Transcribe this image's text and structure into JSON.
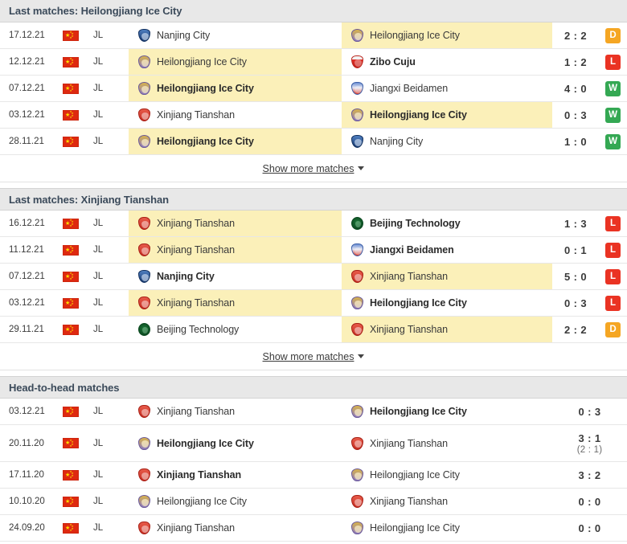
{
  "sections": [
    {
      "id": "last-matches-heilongjiang",
      "title": "Last matches: Heilongjiang Ice City",
      "show_more_label": "Show more matches",
      "has_show_more": true,
      "has_result_badge": true,
      "rows": [
        {
          "date": "17.12.21",
          "country": "China",
          "league": "JL",
          "home": "Nanjing City",
          "home_logo": "nanjing",
          "home_bold": false,
          "home_highlight": false,
          "away": "Heilongjiang Ice City",
          "away_logo": "heilongjiang",
          "away_bold": false,
          "away_highlight": true,
          "score": "2 : 2",
          "score_sub": "",
          "result": "D"
        },
        {
          "date": "12.12.21",
          "country": "China",
          "league": "JL",
          "home": "Heilongjiang Ice City",
          "home_logo": "heilongjiang",
          "home_bold": false,
          "home_highlight": true,
          "away": "Zibo Cuju",
          "away_logo": "zibo",
          "away_bold": true,
          "away_highlight": false,
          "score": "1 : 2",
          "score_sub": "",
          "result": "L"
        },
        {
          "date": "07.12.21",
          "country": "China",
          "league": "JL",
          "home": "Heilongjiang Ice City",
          "home_logo": "heilongjiang",
          "home_bold": true,
          "home_highlight": true,
          "away": "Jiangxi Beidamen",
          "away_logo": "jiangxi",
          "away_bold": false,
          "away_highlight": false,
          "score": "4 : 0",
          "score_sub": "",
          "result": "W"
        },
        {
          "date": "03.12.21",
          "country": "China",
          "league": "JL",
          "home": "Xinjiang Tianshan",
          "home_logo": "xinjiang",
          "home_bold": false,
          "home_highlight": false,
          "away": "Heilongjiang Ice City",
          "away_logo": "heilongjiang",
          "away_bold": true,
          "away_highlight": true,
          "score": "0 : 3",
          "score_sub": "",
          "result": "W"
        },
        {
          "date": "28.11.21",
          "country": "China",
          "league": "JL",
          "home": "Heilongjiang Ice City",
          "home_logo": "heilongjiang",
          "home_bold": true,
          "home_highlight": true,
          "away": "Nanjing City",
          "away_logo": "nanjing",
          "away_bold": false,
          "away_highlight": false,
          "score": "1 : 0",
          "score_sub": "",
          "result": "W"
        }
      ]
    },
    {
      "id": "last-matches-xinjiang",
      "title": "Last matches: Xinjiang Tianshan",
      "show_more_label": "Show more matches",
      "has_show_more": true,
      "has_result_badge": true,
      "rows": [
        {
          "date": "16.12.21",
          "country": "China",
          "league": "JL",
          "home": "Xinjiang Tianshan",
          "home_logo": "xinjiang",
          "home_bold": false,
          "home_highlight": true,
          "away": "Beijing Technology",
          "away_logo": "beijing",
          "away_bold": true,
          "away_highlight": false,
          "score": "1 : 3",
          "score_sub": "",
          "result": "L"
        },
        {
          "date": "11.12.21",
          "country": "China",
          "league": "JL",
          "home": "Xinjiang Tianshan",
          "home_logo": "xinjiang",
          "home_bold": false,
          "home_highlight": true,
          "away": "Jiangxi Beidamen",
          "away_logo": "jiangxi",
          "away_bold": true,
          "away_highlight": false,
          "score": "0 : 1",
          "score_sub": "",
          "result": "L"
        },
        {
          "date": "07.12.21",
          "country": "China",
          "league": "JL",
          "home": "Nanjing City",
          "home_logo": "nanjing",
          "home_bold": true,
          "home_highlight": false,
          "away": "Xinjiang Tianshan",
          "away_logo": "xinjiang",
          "away_bold": false,
          "away_highlight": true,
          "score": "5 : 0",
          "score_sub": "",
          "result": "L"
        },
        {
          "date": "03.12.21",
          "country": "China",
          "league": "JL",
          "home": "Xinjiang Tianshan",
          "home_logo": "xinjiang",
          "home_bold": false,
          "home_highlight": true,
          "away": "Heilongjiang Ice City",
          "away_logo": "heilongjiang",
          "away_bold": true,
          "away_highlight": false,
          "score": "0 : 3",
          "score_sub": "",
          "result": "L"
        },
        {
          "date": "29.11.21",
          "country": "China",
          "league": "JL",
          "home": "Beijing Technology",
          "home_logo": "beijing",
          "home_bold": false,
          "home_highlight": false,
          "away": "Xinjiang Tianshan",
          "away_logo": "xinjiang",
          "away_bold": false,
          "away_highlight": true,
          "score": "2 : 2",
          "score_sub": "",
          "result": "D"
        }
      ]
    },
    {
      "id": "head-to-head-matches",
      "title": "Head-to-head matches",
      "show_more_label": "",
      "has_show_more": false,
      "has_result_badge": false,
      "rows": [
        {
          "date": "03.12.21",
          "country": "China",
          "league": "JL",
          "home": "Xinjiang Tianshan",
          "home_logo": "xinjiang",
          "home_bold": false,
          "home_highlight": false,
          "away": "Heilongjiang Ice City",
          "away_logo": "heilongjiang",
          "away_bold": true,
          "away_highlight": false,
          "score": "0 : 3",
          "score_sub": "",
          "result": ""
        },
        {
          "date": "20.11.20",
          "country": "China",
          "league": "JL",
          "home": "Heilongjiang Ice City",
          "home_logo": "heilongjiang",
          "home_bold": true,
          "home_highlight": false,
          "away": "Xinjiang Tianshan",
          "away_logo": "xinjiang",
          "away_bold": false,
          "away_highlight": false,
          "score": "3 : 1",
          "score_sub": "(2 : 1)",
          "result": ""
        },
        {
          "date": "17.11.20",
          "country": "China",
          "league": "JL",
          "home": "Xinjiang Tianshan",
          "home_logo": "xinjiang",
          "home_bold": true,
          "home_highlight": false,
          "away": "Heilongjiang Ice City",
          "away_logo": "heilongjiang",
          "away_bold": false,
          "away_highlight": false,
          "score": "3 : 2",
          "score_sub": "",
          "result": ""
        },
        {
          "date": "10.10.20",
          "country": "China",
          "league": "JL",
          "home": "Heilongjiang Ice City",
          "home_logo": "heilongjiang",
          "home_bold": false,
          "home_highlight": false,
          "away": "Xinjiang Tianshan",
          "away_logo": "xinjiang",
          "away_bold": false,
          "away_highlight": false,
          "score": "0 : 0",
          "score_sub": "",
          "result": ""
        },
        {
          "date": "24.09.20",
          "country": "China",
          "league": "JL",
          "home": "Xinjiang Tianshan",
          "home_logo": "xinjiang",
          "home_bold": false,
          "home_highlight": false,
          "away": "Heilongjiang Ice City",
          "away_logo": "heilongjiang",
          "away_bold": false,
          "away_highlight": false,
          "score": "0 : 0",
          "score_sub": "",
          "result": ""
        }
      ]
    }
  ],
  "colors": {
    "highlight": "#fbf2bd",
    "header_bg": "#e8e8e8",
    "win": "#34a853",
    "loss": "#ea3323",
    "draw": "#f5a623",
    "flag_red": "#de2910",
    "flag_yellow": "#ffde00"
  }
}
